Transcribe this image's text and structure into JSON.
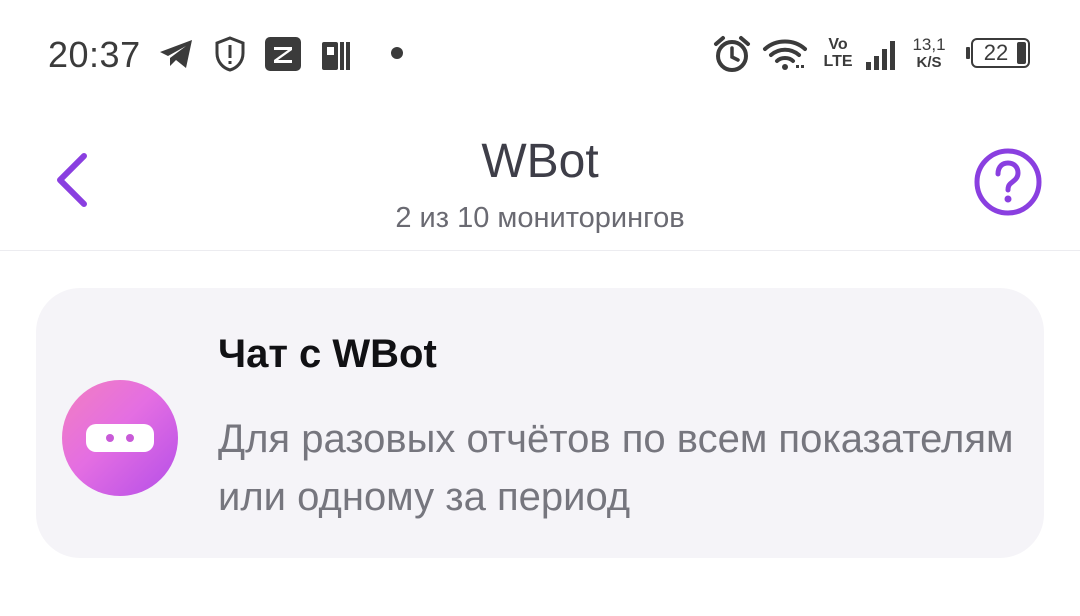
{
  "status_bar": {
    "time": "20:37",
    "left_icons": [
      "telegram-icon",
      "shield-icon",
      "app-z-icon",
      "app-p-icon",
      "dot-icon"
    ],
    "volte_top": "Vo",
    "volte_bottom": "LTE",
    "speed_value": "13,1",
    "speed_unit": "K/S",
    "battery": "22"
  },
  "header": {
    "title": "WBot",
    "subtitle": "2 из 10 мониторингов",
    "accent_color": "#8a3fe0"
  },
  "card": {
    "title": "Чат с WBot",
    "description": "Для разовых отчётов по всем показателям или одному за период"
  }
}
